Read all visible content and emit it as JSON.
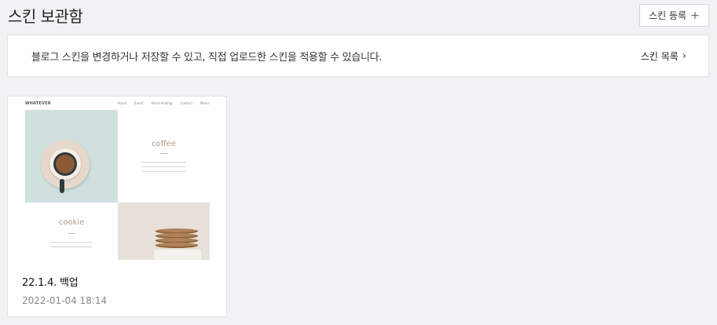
{
  "page": {
    "title": "스킨 보관함",
    "register_button": "스킨 등록",
    "register_icon": "plus-icon"
  },
  "info": {
    "text": "블로그 스킨을 변경하거나 저장할 수 있고, 직접 업로드한 스킨을 적용할 수 있습니다.",
    "link": "스킨 목록",
    "link_icon": "chevron-right-icon"
  },
  "skins": [
    {
      "name": "22.1.4. 백업",
      "date": "2022-01-04 18:14",
      "thumbnail": {
        "logo": "WHATEVER",
        "nav": [
          "About",
          "Event",
          "Hand-making",
          "Contact",
          "Menu"
        ],
        "word_1": "coffee",
        "word_2": "cookie"
      }
    }
  ],
  "colors": {
    "background": "#f1f2f4",
    "card": "#ffffff",
    "border": "#e1e3e6",
    "accent_text": "#b89a80"
  }
}
